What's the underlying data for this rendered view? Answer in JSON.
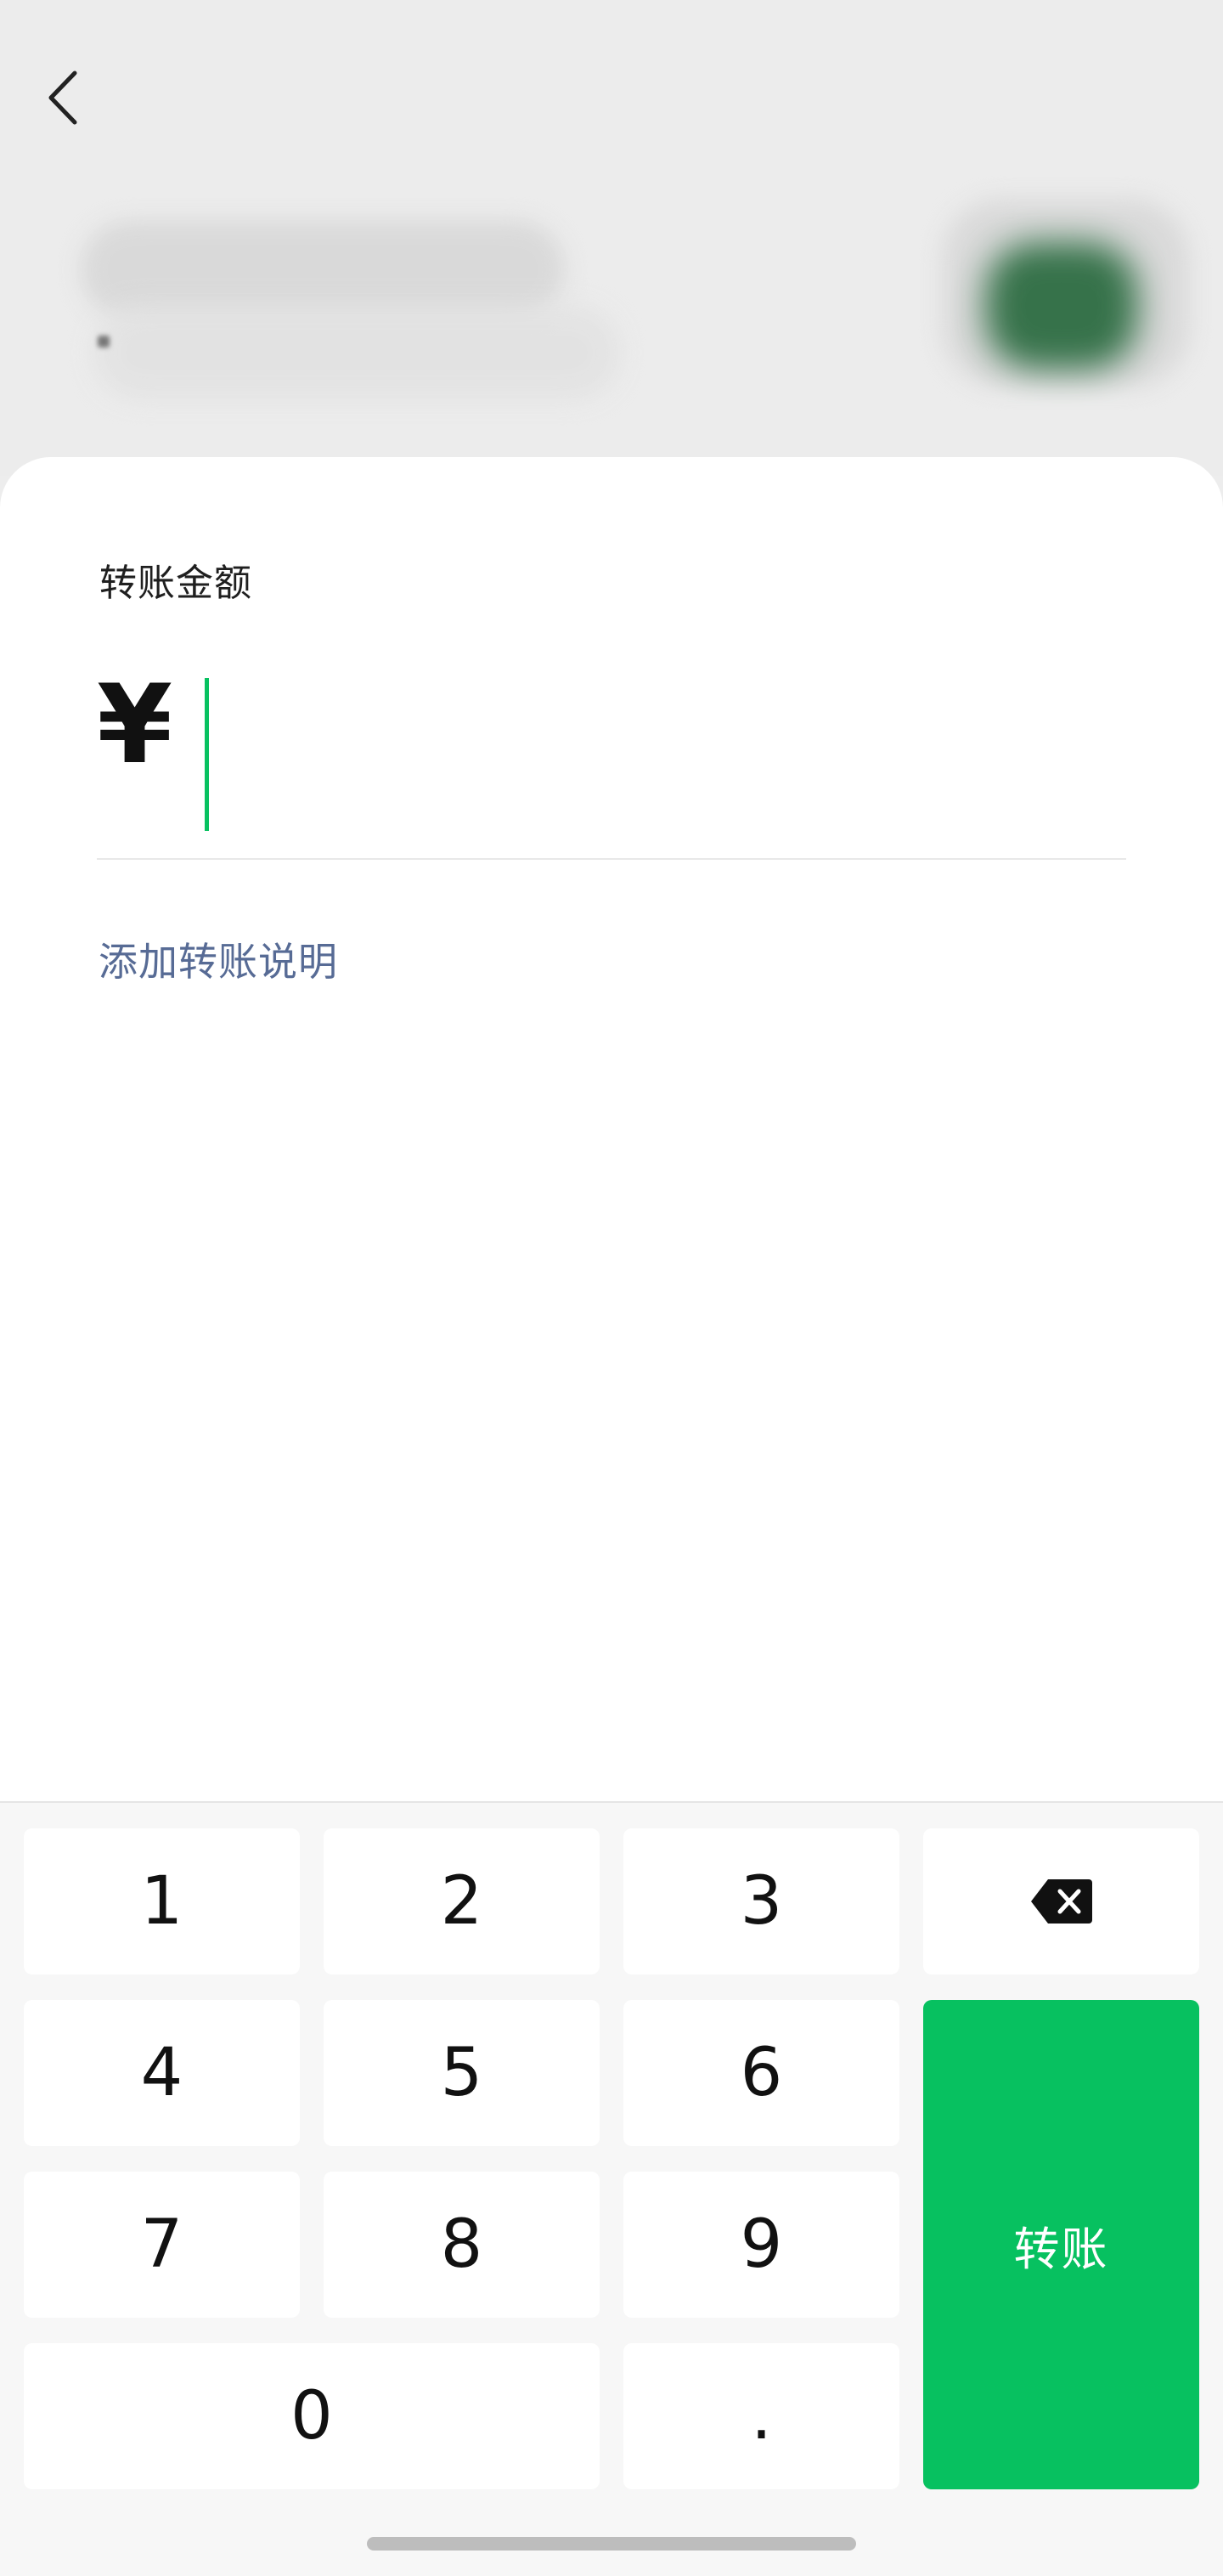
{
  "header": {
    "back_icon": "chevron-left-icon"
  },
  "form": {
    "amount_label": "转账金额",
    "currency_symbol": "¥",
    "amount_value": "",
    "add_note_label": "添加转账说明"
  },
  "keypad": {
    "keys": [
      "1",
      "2",
      "3",
      "4",
      "5",
      "6",
      "7",
      "8",
      "9",
      "0",
      "."
    ],
    "backspace_icon": "backspace-icon",
    "confirm_label": "转账"
  },
  "colors": {
    "accent": "#07c160",
    "link": "#576b95",
    "background": "#ededed"
  }
}
